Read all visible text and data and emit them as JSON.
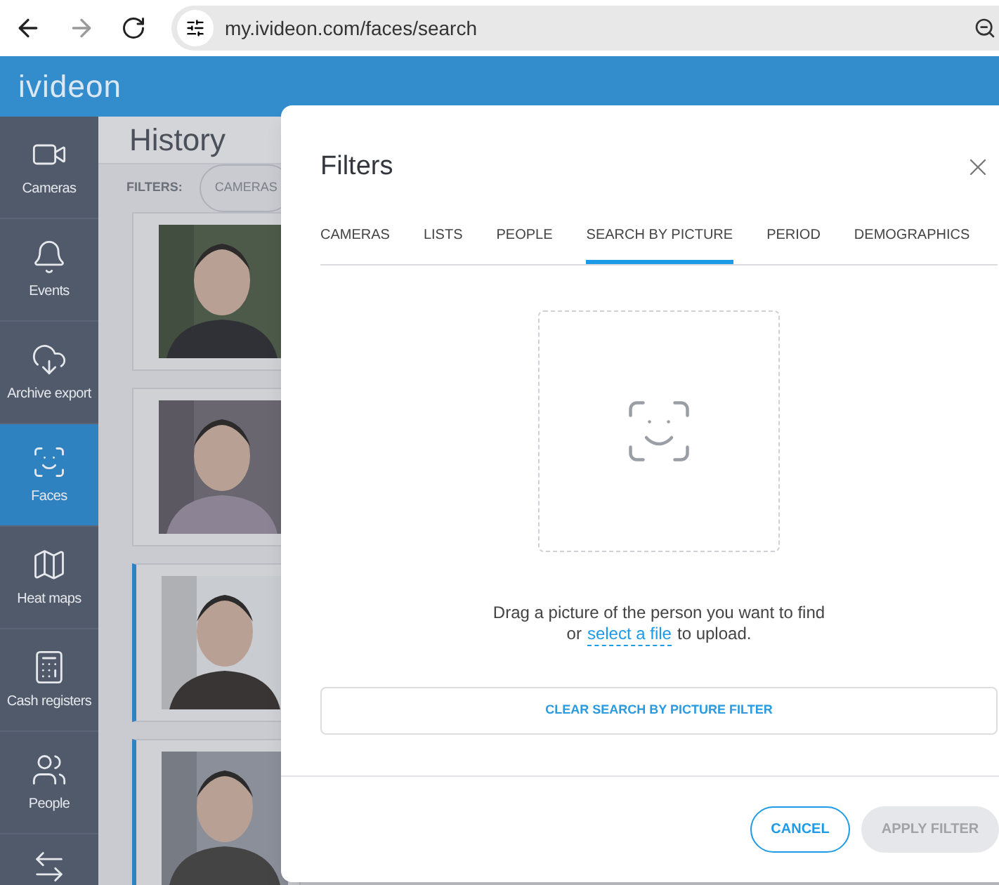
{
  "browser": {
    "url": "my.ivideon.com/faces/search",
    "forward_disabled": true
  },
  "header": {
    "logo": "ivideon"
  },
  "sidebar": {
    "items": [
      {
        "label": "Cameras",
        "selected": false
      },
      {
        "label": "Events",
        "selected": false
      },
      {
        "label": "Archive export",
        "selected": false
      },
      {
        "label": "Faces",
        "selected": true
      },
      {
        "label": "Heat maps",
        "selected": false
      },
      {
        "label": "Cash registers",
        "selected": false
      },
      {
        "label": "People",
        "selected": false
      }
    ]
  },
  "page": {
    "title": "History",
    "filters_label": "FILTERS:",
    "filter_chip": "CAMERAS",
    "cards": [
      {
        "kind": "picture",
        "highlighted": false
      },
      {
        "kind": "picture",
        "highlighted": false
      },
      {
        "kind": "picture",
        "highlighted": true
      },
      {
        "kind": "picture",
        "highlighted": true
      }
    ]
  },
  "dialog": {
    "title": "Filters",
    "tabs": [
      {
        "label": "CAMERAS",
        "selected": false
      },
      {
        "label": "LISTS",
        "selected": false
      },
      {
        "label": "PEOPLE",
        "selected": false
      },
      {
        "label": "SEARCH BY PICTURE",
        "selected": true
      },
      {
        "label": "PERIOD",
        "selected": false
      },
      {
        "label": "DEMOGRAPHICS",
        "selected": false
      }
    ],
    "hint": "Drag a picture of the person you want to find",
    "hint_or": "or",
    "hint_link": "select a file",
    "hint_end": "to upload.",
    "clear_button": "CLEAR SEARCH BY PICTURE FILTER",
    "cancel_button": "CANCEL",
    "apply_button": {
      "label": "APPLY FILTER",
      "disabled": true
    }
  }
}
